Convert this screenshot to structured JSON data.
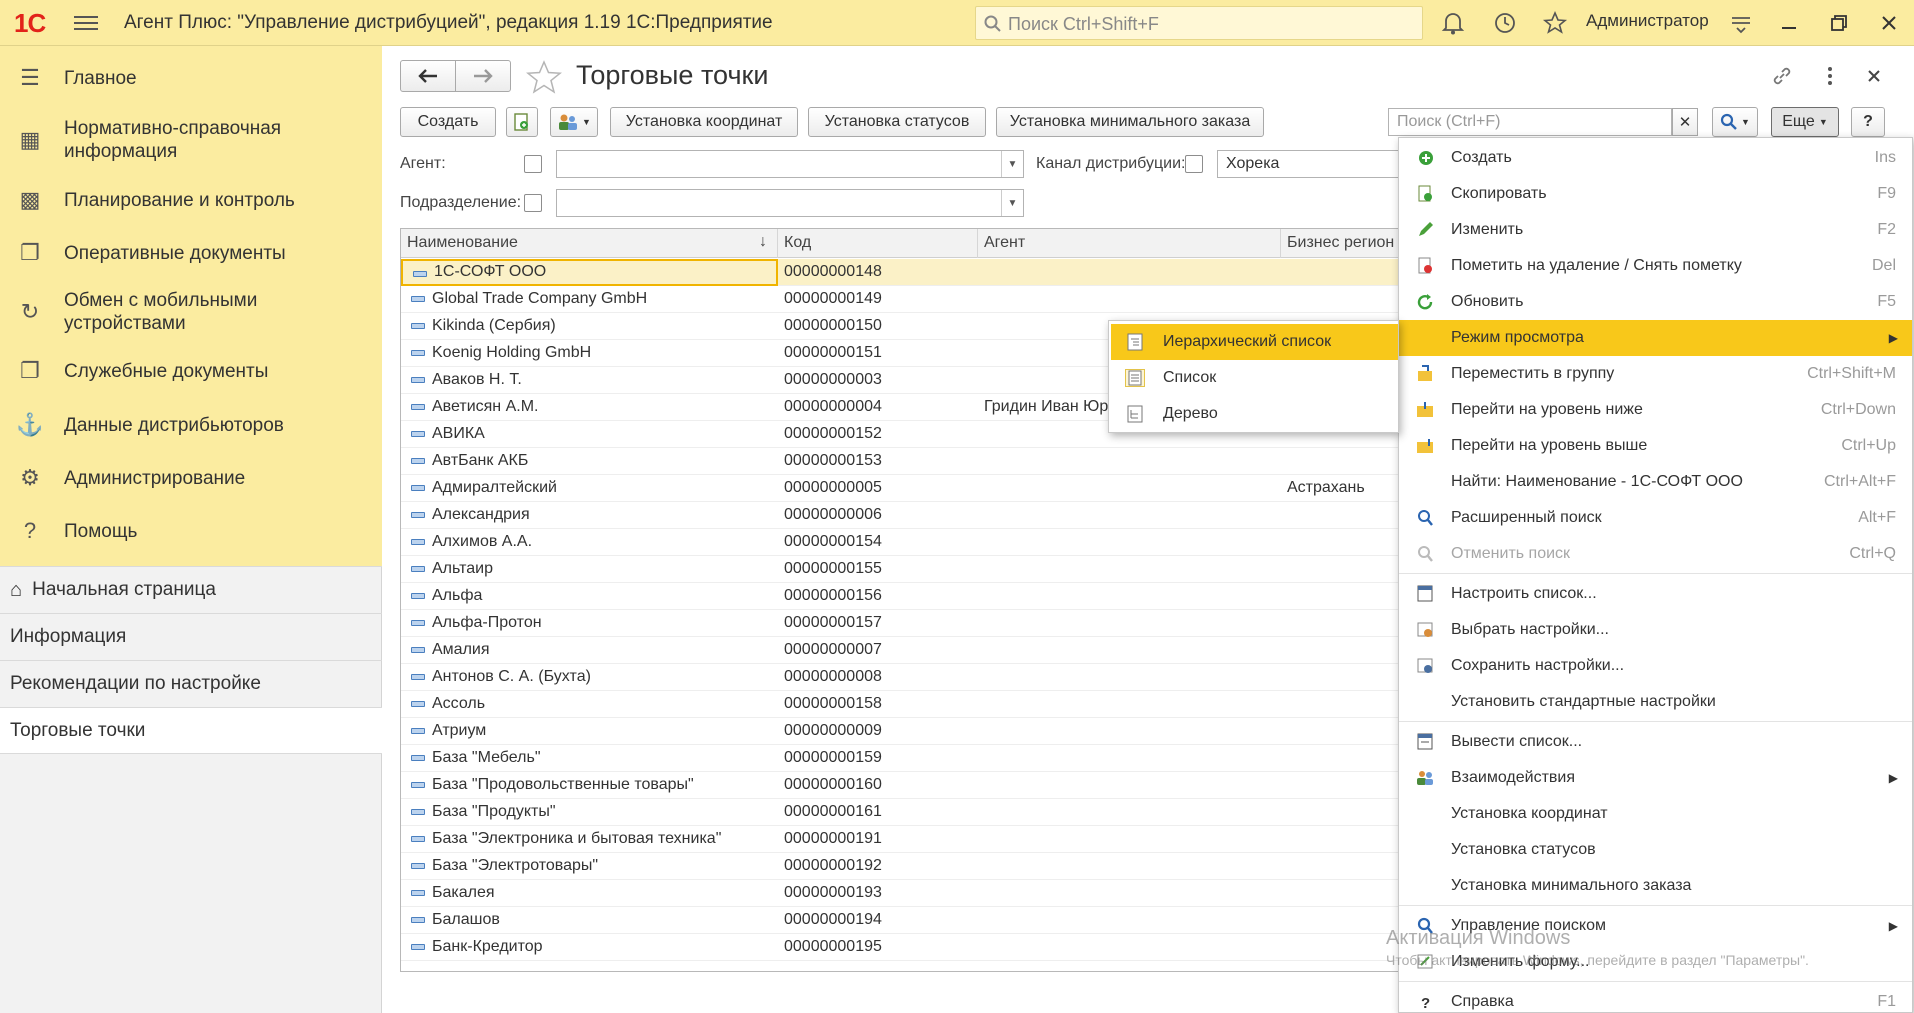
{
  "topbar": {
    "logo": "1С",
    "title": "Агент Плюс: \"Управление дистрибуцией\", редакция 1.19 1С:Предприятие",
    "search_placeholder": "Поиск Ctrl+Shift+F",
    "user": "Администратор"
  },
  "sidebar": {
    "sections": [
      {
        "label": "Главное",
        "icon": "menu-icon"
      },
      {
        "label": "Нормативно-справочная информация",
        "icon": "catalog-icon"
      },
      {
        "label": "Планирование и контроль",
        "icon": "chart-icon"
      },
      {
        "label": "Оперативные документы",
        "icon": "documents-icon"
      },
      {
        "label": "Обмен с мобильными устройствами",
        "icon": "sync-icon"
      },
      {
        "label": "Служебные документы",
        "icon": "service-docs-icon"
      },
      {
        "label": "Данные дистрибьюторов",
        "icon": "distributors-icon"
      },
      {
        "label": "Администрирование",
        "icon": "gear-icon"
      },
      {
        "label": "Помощь",
        "icon": "help-icon"
      }
    ],
    "nav": [
      {
        "label": "Начальная страница"
      },
      {
        "label": "Информация"
      },
      {
        "label": "Рекомендации по настройке"
      },
      {
        "label": "Торговые точки"
      }
    ]
  },
  "form": {
    "title": "Торговые точки",
    "buttons": {
      "create": "Создать",
      "set_coords": "Установка координат",
      "set_statuses": "Установка статусов",
      "set_min_order": "Установка минимального заказа",
      "more": "Еще",
      "help": "?"
    },
    "search_placeholder": "Поиск (Ctrl+F)",
    "filters": {
      "agent_label": "Агент:",
      "agent_value": "",
      "division_label": "Подразделение:",
      "division_value": "",
      "channel_label": "Канал дистрибуции:",
      "channel_value": "Хорека"
    }
  },
  "table": {
    "columns": [
      "Наименование",
      "Код",
      "Агент",
      "Бизнес регион"
    ],
    "rows": [
      {
        "name": "1С-СОФТ ООО",
        "code": "00000000148",
        "agent": "",
        "region": ""
      },
      {
        "name": "Global Trade Company GmbH",
        "code": "00000000149",
        "agent": "",
        "region": ""
      },
      {
        "name": "Kikinda (Сербия)",
        "code": "00000000150",
        "agent": "",
        "region": ""
      },
      {
        "name": "Koenig Holding GmbH",
        "code": "00000000151",
        "agent": "",
        "region": ""
      },
      {
        "name": "Аваков Н. Т.",
        "code": "00000000003",
        "agent": "",
        "region": ""
      },
      {
        "name": "Аветисян А.М.",
        "code": "00000000004",
        "agent": "Гридин Иван Юрь",
        "region": ""
      },
      {
        "name": "АВИКА",
        "code": "00000000152",
        "agent": "",
        "region": ""
      },
      {
        "name": "АвтБанк АКБ",
        "code": "00000000153",
        "agent": "",
        "region": ""
      },
      {
        "name": "Адмиралтейский",
        "code": "00000000005",
        "agent": "",
        "region": "Астрахань"
      },
      {
        "name": "Александрия",
        "code": "00000000006",
        "agent": "",
        "region": ""
      },
      {
        "name": "Алхимов А.А.",
        "code": "00000000154",
        "agent": "",
        "region": ""
      },
      {
        "name": "Альтаир",
        "code": "00000000155",
        "agent": "",
        "region": ""
      },
      {
        "name": "Альфа",
        "code": "00000000156",
        "agent": "",
        "region": ""
      },
      {
        "name": "Альфа-Протон",
        "code": "00000000157",
        "agent": "",
        "region": ""
      },
      {
        "name": "Амалия",
        "code": "00000000007",
        "agent": "",
        "region": ""
      },
      {
        "name": "Антонов С. А. (Бухта)",
        "code": "00000000008",
        "agent": "",
        "region": ""
      },
      {
        "name": "Ассоль",
        "code": "00000000158",
        "agent": "",
        "region": ""
      },
      {
        "name": "Атриум",
        "code": "00000000009",
        "agent": "",
        "region": ""
      },
      {
        "name": "База \"Мебель\"",
        "code": "00000000159",
        "agent": "",
        "region": ""
      },
      {
        "name": "База \"Продовольственные товары\"",
        "code": "00000000160",
        "agent": "",
        "region": ""
      },
      {
        "name": "База \"Продукты\"",
        "code": "00000000161",
        "agent": "",
        "region": ""
      },
      {
        "name": "База \"Электроника и бытовая техника\"",
        "code": "00000000191",
        "agent": "",
        "region": ""
      },
      {
        "name": "База \"Электротовары\"",
        "code": "00000000192",
        "agent": "",
        "region": ""
      },
      {
        "name": "Бакалея",
        "code": "00000000193",
        "agent": "",
        "region": ""
      },
      {
        "name": "Балашов",
        "code": "00000000194",
        "agent": "",
        "region": ""
      },
      {
        "name": "Банк-Кредитор",
        "code": "00000000195",
        "agent": "",
        "region": ""
      }
    ]
  },
  "more_menu": {
    "items": [
      {
        "label": "Создать",
        "shortcut": "Ins",
        "icon": "plus-icon"
      },
      {
        "label": "Скопировать",
        "shortcut": "F9",
        "icon": "copy-icon"
      },
      {
        "label": "Изменить",
        "shortcut": "F2",
        "icon": "pencil-icon"
      },
      {
        "label": "Пометить на удаление / Снять пометку",
        "shortcut": "Del",
        "icon": "delete-mark-icon"
      },
      {
        "label": "Обновить",
        "shortcut": "F5",
        "icon": "refresh-icon"
      },
      {
        "label": "Режим просмотра",
        "shortcut": "",
        "icon": "",
        "submenu": true,
        "highlighted": true
      },
      {
        "label": "Переместить в группу",
        "shortcut": "Ctrl+Shift+M",
        "icon": "move-group-icon"
      },
      {
        "label": "Перейти на уровень ниже",
        "shortcut": "Ctrl+Down",
        "icon": "folder-down-icon"
      },
      {
        "label": "Перейти на уровень выше",
        "shortcut": "Ctrl+Up",
        "icon": "folder-up-icon"
      },
      {
        "label": "Найти: Наименование - 1С-СОФТ ООО",
        "shortcut": "Ctrl+Alt+F",
        "icon": ""
      },
      {
        "label": "Расширенный поиск",
        "shortcut": "Alt+F",
        "icon": "advanced-search-icon"
      },
      {
        "label": "Отменить поиск",
        "shortcut": "Ctrl+Q",
        "icon": "cancel-search-icon",
        "disabled": true
      },
      {
        "label": "Настроить список...",
        "shortcut": "",
        "icon": "list-settings-icon",
        "sep_before": true
      },
      {
        "label": "Выбрать настройки...",
        "shortcut": "",
        "icon": "choose-settings-icon"
      },
      {
        "label": "Сохранить настройки...",
        "shortcut": "",
        "icon": "save-settings-icon"
      },
      {
        "label": "Установить стандартные настройки",
        "shortcut": "",
        "icon": ""
      },
      {
        "label": "Вывести список...",
        "shortcut": "",
        "icon": "print-list-icon",
        "sep_before": true
      },
      {
        "label": "Взаимодействия",
        "shortcut": "",
        "icon": "interactions-icon",
        "submenu": true
      },
      {
        "label": "Установка координат",
        "shortcut": "",
        "icon": ""
      },
      {
        "label": "Установка статусов",
        "shortcut": "",
        "icon": ""
      },
      {
        "label": "Установка минимального заказа",
        "shortcut": "",
        "icon": ""
      },
      {
        "label": "Управление поиском",
        "shortcut": "",
        "icon": "search-control-icon",
        "submenu": true,
        "sep_before": true
      },
      {
        "label": "Изменить форму...",
        "shortcut": "",
        "icon": "edit-form-icon"
      },
      {
        "label": "Справка",
        "shortcut": "F1",
        "icon": "help-icon",
        "sep_before": true
      }
    ]
  },
  "view_submenu": {
    "items": [
      {
        "label": "Иерархический список",
        "highlighted": true
      },
      {
        "label": "Список"
      },
      {
        "label": "Дерево"
      }
    ]
  },
  "watermark": {
    "line1": "Активация Windows",
    "line2": "Чтобы активировать Windows, перейдите в раздел \"Параметры\"."
  },
  "colors": {
    "accent": "#f8c81a",
    "panel": "#fbeca0"
  }
}
